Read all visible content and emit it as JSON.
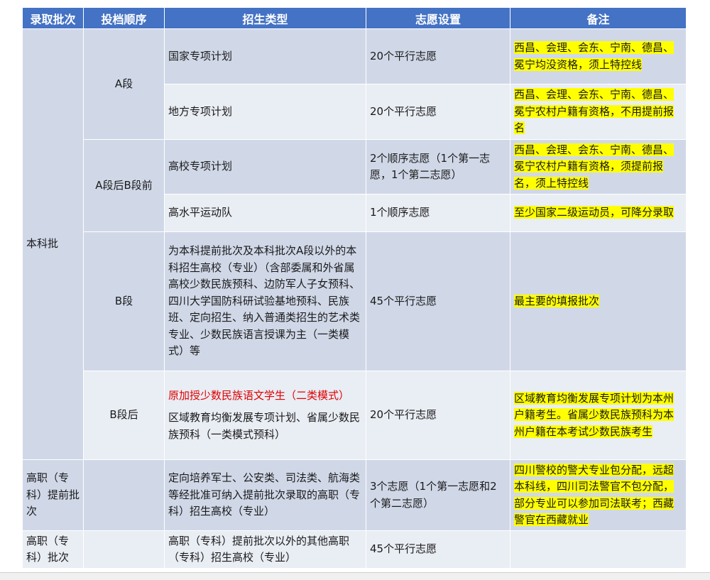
{
  "header": {
    "batch": "录取批次",
    "order": "投档顺序",
    "type": "招生类型",
    "choice": "志愿设置",
    "remark": "备注"
  },
  "groups": {
    "undergrad": "本科批",
    "a_segment": "A段",
    "after_a_before_b": "A段后B段前",
    "b_segment": "B段",
    "after_b": "B段后",
    "voc_early": "高职（专科）提前批次",
    "voc": "高职（专科）批次"
  },
  "rows": [
    {
      "type": "国家专项计划",
      "choice": "20个平行志愿",
      "remark": "西昌、会理、会东、宁南、德昌、冕宁均没资格，须上特控线"
    },
    {
      "type": "地方专项计划",
      "choice": "20个平行志愿",
      "remark": "西昌、会理、会东、宁南、德昌、冕宁农村户籍有资格，不用提前报名"
    },
    {
      "type": "高校专项计划",
      "choice": "2个顺序志愿（1个第一志愿，1个第二志愿）",
      "remark": "西昌、会理、会东、宁南、德昌、冕宁农村户籍有资格，须提前报名，须上特控线"
    },
    {
      "type": "高水平运动队",
      "choice": "1个顺序志愿",
      "remark": "至少国家二级运动员，可降分录取"
    },
    {
      "type": "为本科提前批次及本科批次A段以外的本科招生高校（专业）（含部委属和外省属高校少数民族预科、边防军人子女预科、四川大学国防科研试验基地预科、民族班、定向招生、纳入普通类招生的艺术类专业、少数民族语言授课为主（一类模式）等",
      "choice": "45个平行志愿",
      "remark": "最主要的填报批次"
    },
    {
      "type_red": "原加授少数民族语文学生（二类模式）",
      "type": "区域教育均衡发展专项计划、省属少数民族预科（一类模式预科）",
      "choice": "20个平行志愿",
      "remark": "区域教育均衡发展专项计划为本州户籍考生。省属少数民族预科为本州户籍在本考试少数民族考生"
    },
    {
      "type": "定向培养军士、公安类、司法类、航海类等经批准可纳入提前批次录取的高职（专科）招生高校（专业）",
      "choice": "3个志愿（1个第一志愿和2个第二志愿）",
      "remark": "四川警校的警犬专业包分配，远超本科线，四川司法警官不包分配，部分专业可以参加司法联考；西藏警官在西藏就业"
    },
    {
      "type": "高职（专科）提前批次以外的其他高职（专科）招生高校（专业）",
      "choice": "45个平行志愿",
      "remark": ""
    }
  ],
  "colors": {
    "header_bg": "#4472c4",
    "row_dark": "#d0d8e8",
    "row_light": "#e9edf4",
    "highlight": "#ffff00",
    "red_text": "#e00000"
  }
}
